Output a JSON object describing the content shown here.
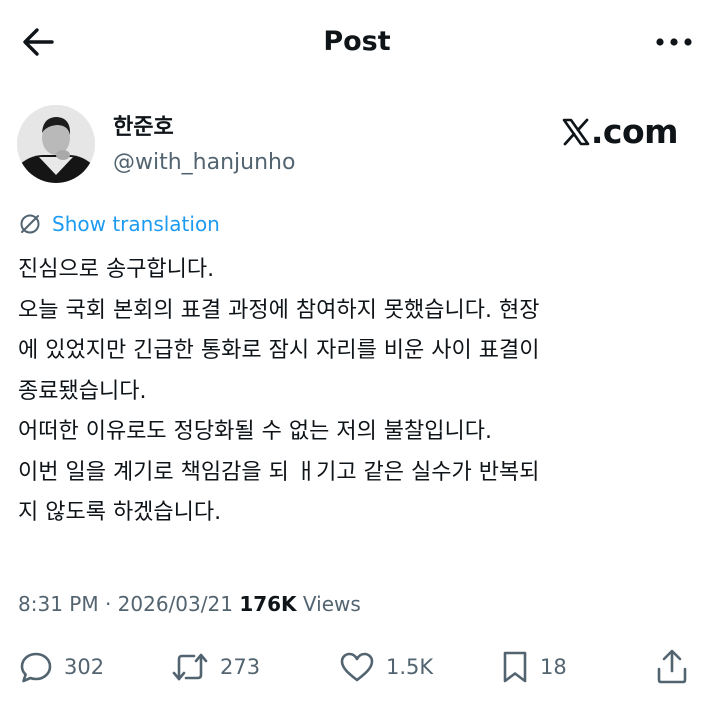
{
  "header": {
    "title": "Post"
  },
  "author": {
    "name": "한준호",
    "handle": "@with_hanjunho"
  },
  "source": {
    "logo_text": ".com"
  },
  "translate": {
    "label": "Show translation"
  },
  "post": {
    "lines": [
      "진심으로 송구합니다.",
      "오늘 국회 본회의 표결 과정에 참여하지 못했습니다. 현장",
      "에 있었지만 긴급한 통화로 잠시 자리를 비운 사이 표결이",
      "종료됐습니다.",
      "어떠한 이유로도 정당화될 수 없는 저의 불찰입니다.",
      "이번 일을 계기로 책임감을 되 ㅐ기고 같은 실수가 반복되",
      "지 않도록 하겠습니다."
    ]
  },
  "meta": {
    "time": "8:31 PM",
    "separator": " · ",
    "date": "2026/03/21",
    "views_count": "176K",
    "views_label": "Views"
  },
  "actions": {
    "replies": "302",
    "reposts": "273",
    "likes": "1.5K",
    "bookmarks": "18"
  },
  "icons": [
    "back-arrow-icon",
    "more-icon",
    "translate-icon",
    "reply-icon",
    "repost-icon",
    "like-icon",
    "bookmark-icon",
    "share-icon",
    "x-logo-icon"
  ],
  "colors": {
    "accent": "#1d9bf0",
    "secondary_text": "#536471",
    "primary_text": "#0f1419"
  }
}
